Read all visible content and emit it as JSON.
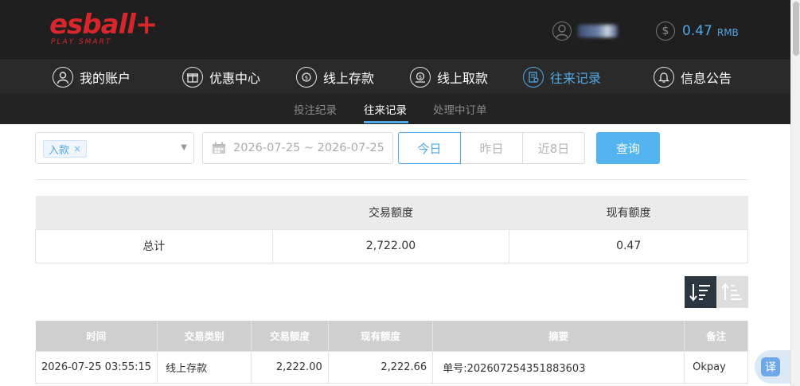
{
  "brand": {
    "logo": "esball+",
    "tagline": "PLAY SMART"
  },
  "account": {
    "balance": "0.47",
    "currency": "RMB"
  },
  "nav": [
    {
      "label": "我的账户",
      "icon": "user-circle-icon"
    },
    {
      "label": "优惠中心",
      "icon": "gift-icon"
    },
    {
      "label": "线上存款",
      "icon": "deposit-icon"
    },
    {
      "label": "线上取款",
      "icon": "withdraw-icon"
    },
    {
      "label": "往来记录",
      "icon": "records-icon",
      "active": true
    },
    {
      "label": "信息公告",
      "icon": "bell-icon"
    }
  ],
  "subnav": [
    {
      "label": "投注纪录"
    },
    {
      "label": "往来记录",
      "active": true
    },
    {
      "label": "处理中订单"
    }
  ],
  "filters": {
    "type_tag": "入款",
    "tag_remove": "×",
    "date_range": "2026-07-25 ~ 2026-07-25",
    "ranges": [
      "今日",
      "昨日",
      "近8日"
    ],
    "active_range": "今日",
    "query_label": "查询"
  },
  "summary": {
    "headers": [
      "",
      "交易额度",
      "现有额度"
    ],
    "row": [
      "总计",
      "2,722.00",
      "0.47"
    ]
  },
  "records": {
    "headers": [
      "时间",
      "交易类别",
      "交易额度",
      "现有额度",
      "摘要",
      "备注"
    ],
    "rows": [
      [
        "2026-07-25 03:55:15",
        "线上存款",
        "2,222.00",
        "2,222.66",
        "单号:202607254351883603",
        "Okpay"
      ]
    ]
  },
  "colors": {
    "accent": "#4fa8e6",
    "brand_red": "#d8262b",
    "header_bg": "#1f1f1f"
  },
  "translate_label": "译"
}
